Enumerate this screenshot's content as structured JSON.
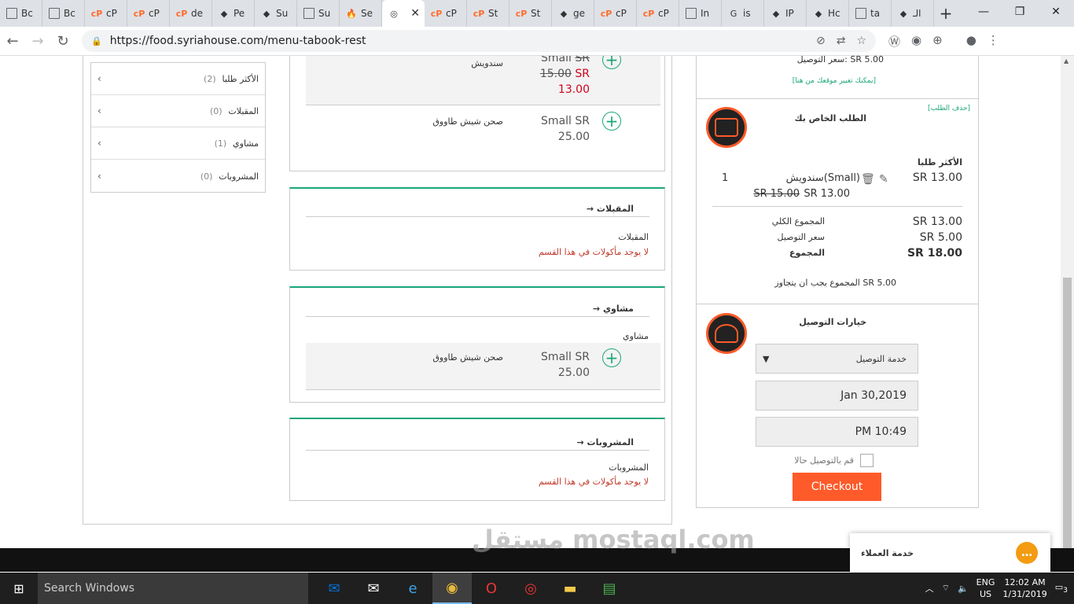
{
  "browser": {
    "tabs": [
      {
        "icon": "doc",
        "label": "Bc"
      },
      {
        "icon": "doc",
        "label": "Bc"
      },
      {
        "icon": "cp",
        "label": "cP"
      },
      {
        "icon": "cp",
        "label": "cP"
      },
      {
        "icon": "cp",
        "label": "de"
      },
      {
        "icon": "other",
        "label": "Pe"
      },
      {
        "icon": "other",
        "label": "Su"
      },
      {
        "icon": "doc",
        "label": "Su"
      },
      {
        "icon": "fire",
        "label": "Se"
      },
      {
        "icon": "active",
        "label": ""
      },
      {
        "icon": "cp",
        "label": "cP"
      },
      {
        "icon": "cp",
        "label": "St"
      },
      {
        "icon": "cp",
        "label": "St"
      },
      {
        "icon": "other",
        "label": "ge"
      },
      {
        "icon": "cp",
        "label": "cP"
      },
      {
        "icon": "cp",
        "label": "cP"
      },
      {
        "icon": "doc",
        "label": "In"
      },
      {
        "icon": "google",
        "label": "is"
      },
      {
        "icon": "other",
        "label": "IP"
      },
      {
        "icon": "other",
        "label": "Hc"
      },
      {
        "icon": "doc",
        "label": "ta"
      },
      {
        "icon": "other",
        "label": "الـ"
      }
    ],
    "url": "https://food.syriahouse.com/menu-tabook-rest"
  },
  "categories": [
    {
      "name": "الأكثر طلبا",
      "count": "(2)"
    },
    {
      "name": "المقبلات",
      "count": "(0)"
    },
    {
      "name": "مشاوي",
      "count": "(1)"
    },
    {
      "name": "المشروبات",
      "count": "(0)"
    }
  ],
  "menu": {
    "top_items": [
      {
        "name": "سندويش",
        "size": "Small",
        "cur": "SR",
        "old": "15.00",
        "cur2": "SR",
        "price": "13.00"
      },
      {
        "name": "صحن شيش طاووق",
        "size": "Small SR",
        "price": "25.00"
      }
    ],
    "sec_appetizers": {
      "title": "→ المقبلات",
      "sub": "المقبلات",
      "empty": "لا يوجد مأكولات في هذا القسم"
    },
    "sec_grill": {
      "title": "→ مشاوي",
      "sub": "مشاوي",
      "item_name": "صحن شيش طاووق",
      "item_size": "Small SR",
      "item_price": "25.00"
    },
    "sec_drinks": {
      "title": "→ المشروبات",
      "sub": "المشروبات",
      "empty": "لا يوجد مأكولات في هذا القسم"
    }
  },
  "cart": {
    "delivery_fee_line": "سعر التوصيل: SR 5.00",
    "change_location": "[يمكنك تغيير موقعك من هنا]",
    "clear": "[حذف الطلب]",
    "title": "الطلب الخاص بك",
    "group": "الأكثر طلبا",
    "line_price": "SR 13.00",
    "line_name": "سندويش(Small)",
    "line_old": "SR 15.00",
    "line_new": "SR 13.00",
    "line_qty": "1",
    "subtotal_label": "المجموع الكلي",
    "subtotal": "SR 13.00",
    "delivery_label": "سعر التوصيل",
    "delivery": "SR 5.00",
    "total_label": "المجموع",
    "total": "SR 18.00",
    "min_note": "المجموع يجب ان يتجاوز SR 5.00",
    "delivery_options": "خيارات التوصيل",
    "service": "خدمة التوصيل",
    "date": "Jan 30,2019",
    "time": "PM 10:49",
    "now_label": "قم بالتوصيل حالا",
    "checkout": "Checkout"
  },
  "support": "خدمة العملاء",
  "watermark": "مستقل mostaql.com",
  "taskbar": {
    "search": "Search Windows",
    "lang1": "ENG",
    "lang2": "US",
    "time": "12:02 AM",
    "date": "1/31/2019",
    "notif": "3"
  }
}
